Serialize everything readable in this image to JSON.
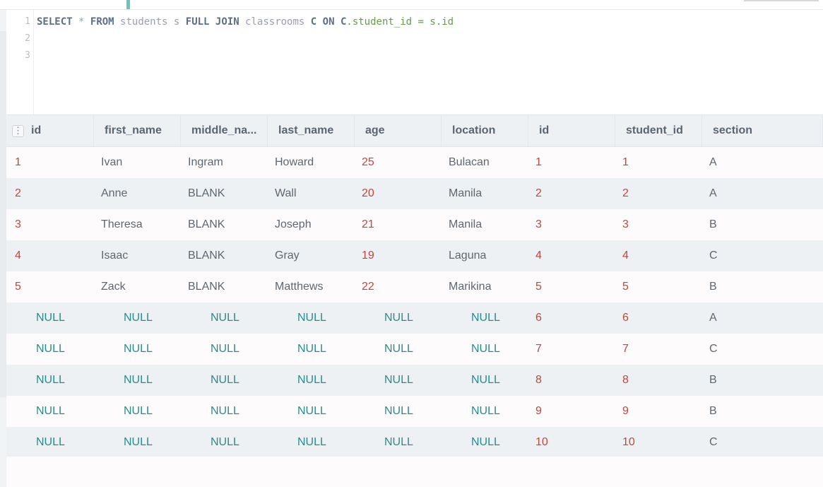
{
  "editor": {
    "line_numbers": [
      "1",
      "2",
      "3"
    ],
    "query_tokens": [
      {
        "t": "SELECT",
        "c": "kw"
      },
      {
        "t": " ",
        "c": "ident"
      },
      {
        "t": "*",
        "c": "op"
      },
      {
        "t": " ",
        "c": "ident"
      },
      {
        "t": "FROM",
        "c": "kw"
      },
      {
        "t": " students s ",
        "c": "ident"
      },
      {
        "t": "FULL JOIN",
        "c": "kw"
      },
      {
        "t": " classrooms ",
        "c": "ident"
      },
      {
        "t": "C",
        "c": "kw"
      },
      {
        "t": " ",
        "c": "ident"
      },
      {
        "t": "ON",
        "c": "kw"
      },
      {
        "t": " ",
        "c": "ident"
      },
      {
        "t": "C",
        "c": "kw"
      },
      {
        "t": ".student_id = s.id",
        "c": "grn"
      }
    ]
  },
  "results": {
    "columns": [
      "id",
      "first_name",
      "middle_na...",
      "last_name",
      "age",
      "location",
      "id",
      "student_id",
      "section"
    ],
    "rows": [
      [
        "1",
        "Ivan",
        "Ingram",
        "Howard",
        "25",
        "Bulacan",
        "1",
        "1",
        "A"
      ],
      [
        "2",
        "Anne",
        "BLANK",
        "Wall",
        "20",
        "Manila",
        "2",
        "2",
        "A"
      ],
      [
        "3",
        "Theresa",
        "BLANK",
        "Joseph",
        "21",
        "Manila",
        "3",
        "3",
        "B"
      ],
      [
        "4",
        "Isaac",
        "BLANK",
        "Gray",
        "19",
        "Laguna",
        "4",
        "4",
        "C"
      ],
      [
        "5",
        "Zack",
        "BLANK",
        "Matthews",
        "22",
        "Marikina",
        "5",
        "5",
        "B"
      ],
      [
        "NULL",
        "NULL",
        "NULL",
        "NULL",
        "NULL",
        "NULL",
        "6",
        "6",
        "A"
      ],
      [
        "NULL",
        "NULL",
        "NULL",
        "NULL",
        "NULL",
        "NULL",
        "7",
        "7",
        "C"
      ],
      [
        "NULL",
        "NULL",
        "NULL",
        "NULL",
        "NULL",
        "NULL",
        "8",
        "8",
        "B"
      ],
      [
        "NULL",
        "NULL",
        "NULL",
        "NULL",
        "NULL",
        "NULL",
        "9",
        "9",
        "B"
      ],
      [
        "NULL",
        "NULL",
        "NULL",
        "NULL",
        "NULL",
        "NULL",
        "10",
        "10",
        "C"
      ]
    ]
  },
  "colors": {
    "number": "#c4453c",
    "text": "#5e6770",
    "null": "#2a8c8a",
    "header_bg": "#eef1f3",
    "accent": "#6fc3c1"
  }
}
